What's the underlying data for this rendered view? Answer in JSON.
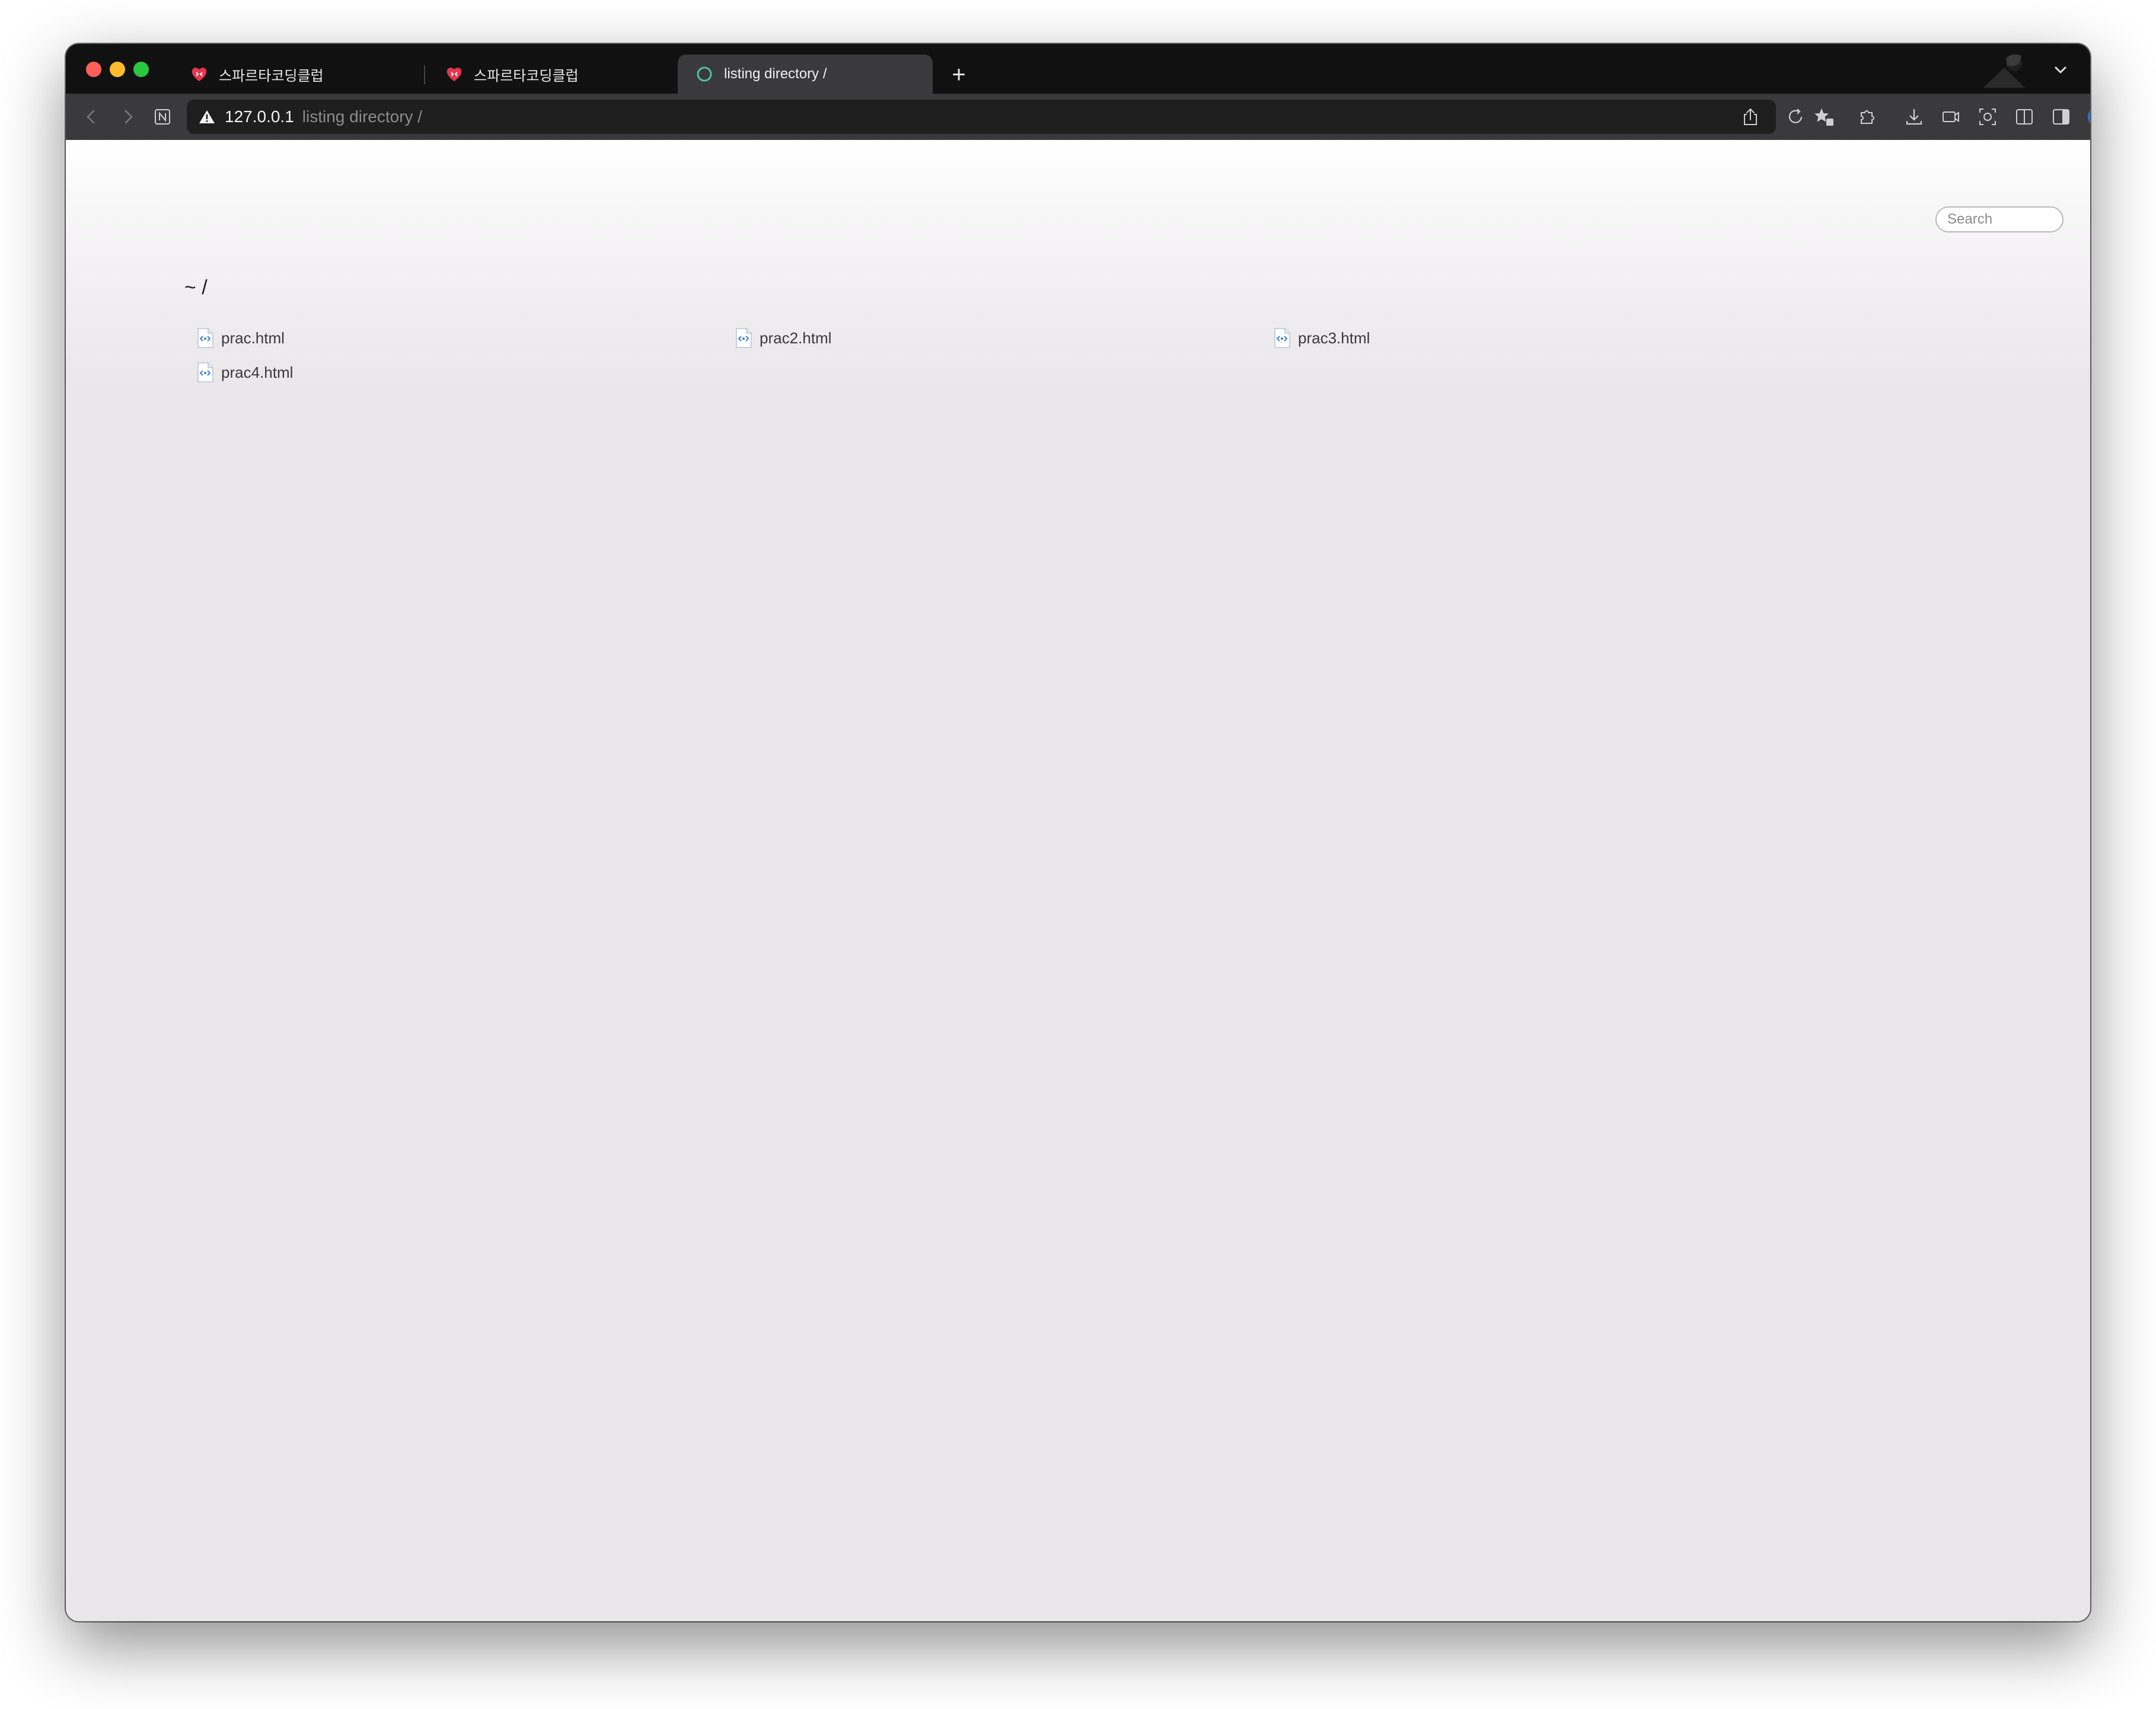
{
  "browser": {
    "tabs": [
      {
        "label": "스파르타코딩클럽",
        "active": false,
        "favicon": "heart-logo-icon"
      },
      {
        "label": "스파르타코딩클럽",
        "active": false,
        "favicon": "heart-logo-icon"
      },
      {
        "label": "listing directory /",
        "active": true,
        "favicon": "loading-circle-icon"
      }
    ],
    "new_tab_label": "+",
    "address": {
      "host": "127.0.0.1",
      "page_title": "listing directory /"
    },
    "profile_badge": "0"
  },
  "page": {
    "search_placeholder": "Search",
    "breadcrumb": "~ /",
    "files": [
      {
        "name": "prac.html"
      },
      {
        "name": "prac2.html"
      },
      {
        "name": "prac3.html"
      },
      {
        "name": "prac4.html"
      }
    ]
  },
  "colors": {
    "tab_strip": "#111111",
    "toolbar": "#3a3a3c",
    "active_tab": "#3a3a3c",
    "page_bg": "#e9e7e9",
    "brand_heart": "#e8344e",
    "loading_ring": "#4cc3a0",
    "profile": "#2f6fe0"
  }
}
